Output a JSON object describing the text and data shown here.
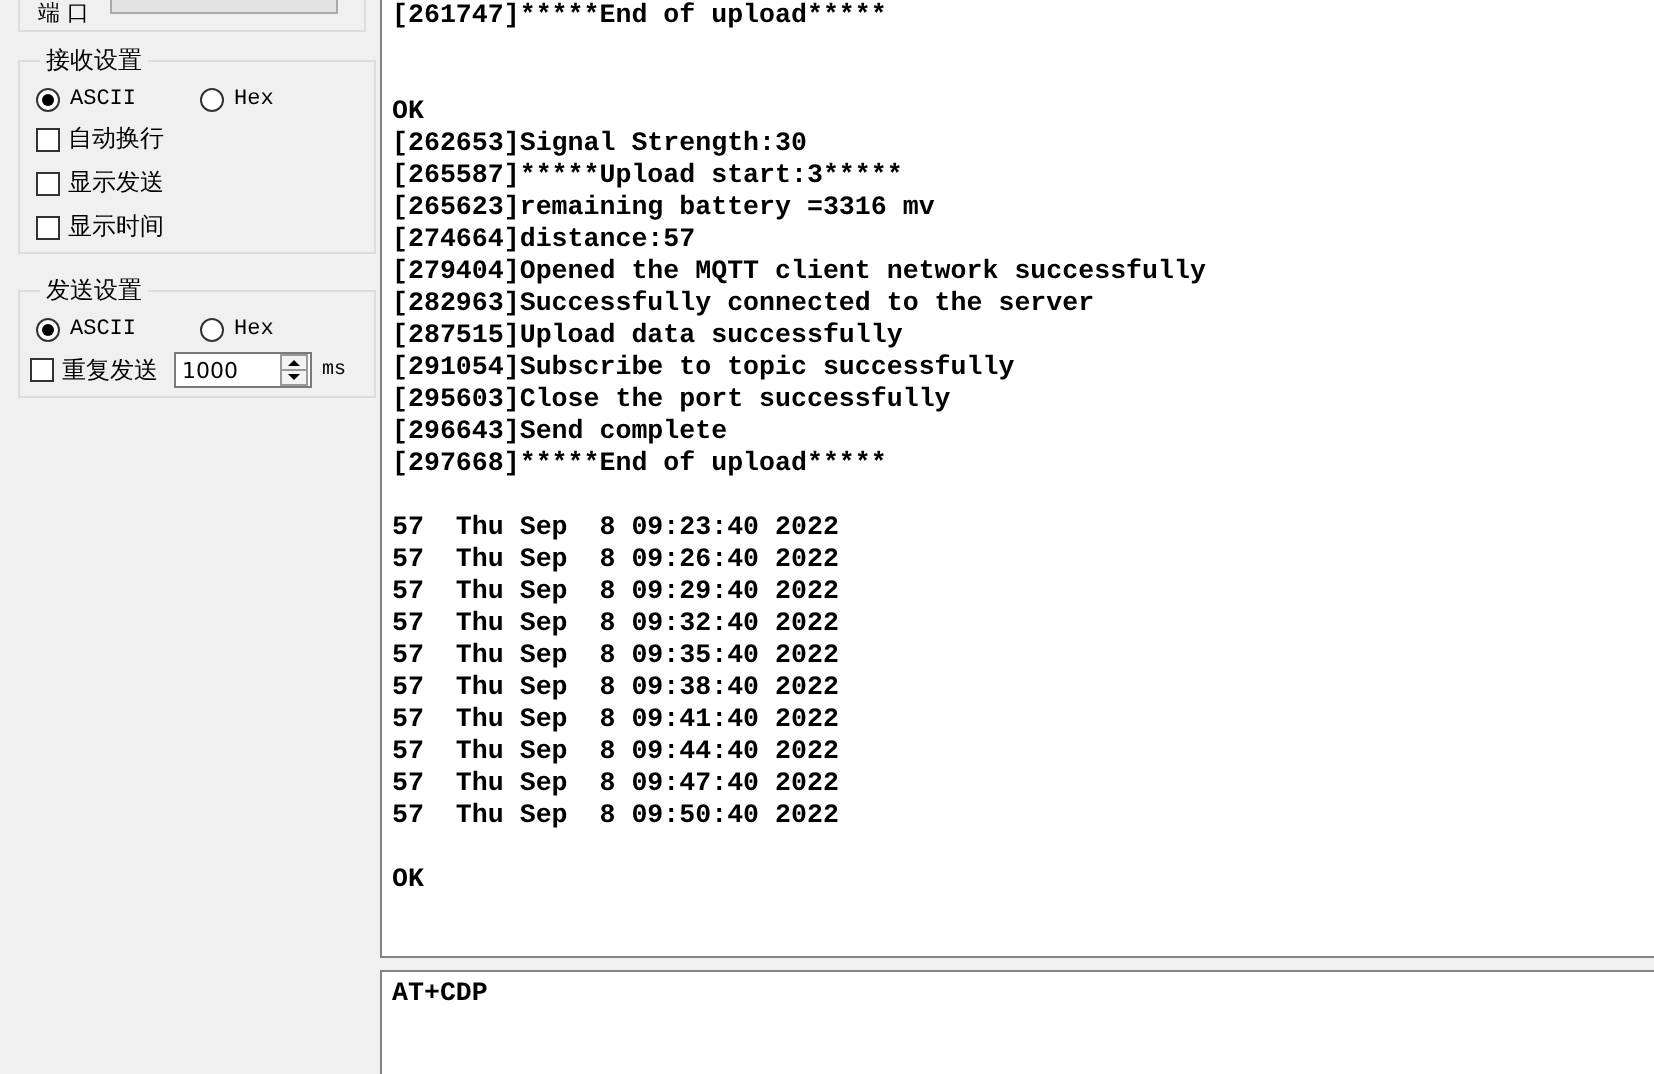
{
  "port": {
    "label": "端 口"
  },
  "receive_settings": {
    "title": "接收设置",
    "modes": [
      {
        "label": "ASCII",
        "selected": true
      },
      {
        "label": "Hex",
        "selected": false
      }
    ],
    "options": [
      {
        "label": "自动换行",
        "checked": false
      },
      {
        "label": "显示发送",
        "checked": false
      },
      {
        "label": "显示时间",
        "checked": false
      }
    ]
  },
  "send_settings": {
    "title": "发送设置",
    "modes": [
      {
        "label": "ASCII",
        "selected": true
      },
      {
        "label": "Hex",
        "selected": false
      }
    ],
    "repeat": {
      "label": "重复发送",
      "checked": false,
      "value": "1000",
      "unit": "ms"
    }
  },
  "log": {
    "lines": [
      {
        "kind": "text",
        "text": "[261747]*****End of upload*****"
      },
      {
        "kind": "blank"
      },
      {
        "kind": "blank"
      },
      {
        "kind": "text",
        "text": "OK"
      },
      {
        "kind": "text",
        "text": "[262653]Signal Strength:30"
      },
      {
        "kind": "text",
        "text": "[265587]*****Upload start:3*****"
      },
      {
        "kind": "text",
        "text": "[265623]remaining battery =3316 mv"
      },
      {
        "kind": "text",
        "text": "[274664]distance:57"
      },
      {
        "kind": "text",
        "text": "[279404]Opened the MQTT client network successfully"
      },
      {
        "kind": "text",
        "text": "[282963]Successfully connected to the server"
      },
      {
        "kind": "text",
        "text": "[287515]Upload data successfully"
      },
      {
        "kind": "text",
        "text": "[291054]Subscribe to topic successfully"
      },
      {
        "kind": "text",
        "text": "[295603]Close the port successfully"
      },
      {
        "kind": "text",
        "text": "[296643]Send complete"
      },
      {
        "kind": "text",
        "text": "[297668]*****End of upload*****"
      },
      {
        "kind": "blank"
      },
      {
        "kind": "text",
        "text": "57  Thu Sep  8 09:23:40 2022"
      },
      {
        "kind": "text",
        "text": "57  Thu Sep  8 09:26:40 2022"
      },
      {
        "kind": "text",
        "text": "57  Thu Sep  8 09:29:40 2022"
      },
      {
        "kind": "text",
        "text": "57  Thu Sep  8 09:32:40 2022"
      },
      {
        "kind": "text",
        "text": "57  Thu Sep  8 09:35:40 2022"
      },
      {
        "kind": "text",
        "text": "57  Thu Sep  8 09:38:40 2022"
      },
      {
        "kind": "text",
        "text": "57  Thu Sep  8 09:41:40 2022"
      },
      {
        "kind": "text",
        "text": "57  Thu Sep  8 09:44:40 2022"
      },
      {
        "kind": "text",
        "text": "57  Thu Sep  8 09:47:40 2022"
      },
      {
        "kind": "text",
        "text": "57  Thu Sep  8 09:50:40 2022"
      },
      {
        "kind": "blank"
      },
      {
        "kind": "text",
        "text": "OK"
      }
    ]
  },
  "send_box": {
    "value": "AT+CDP"
  }
}
